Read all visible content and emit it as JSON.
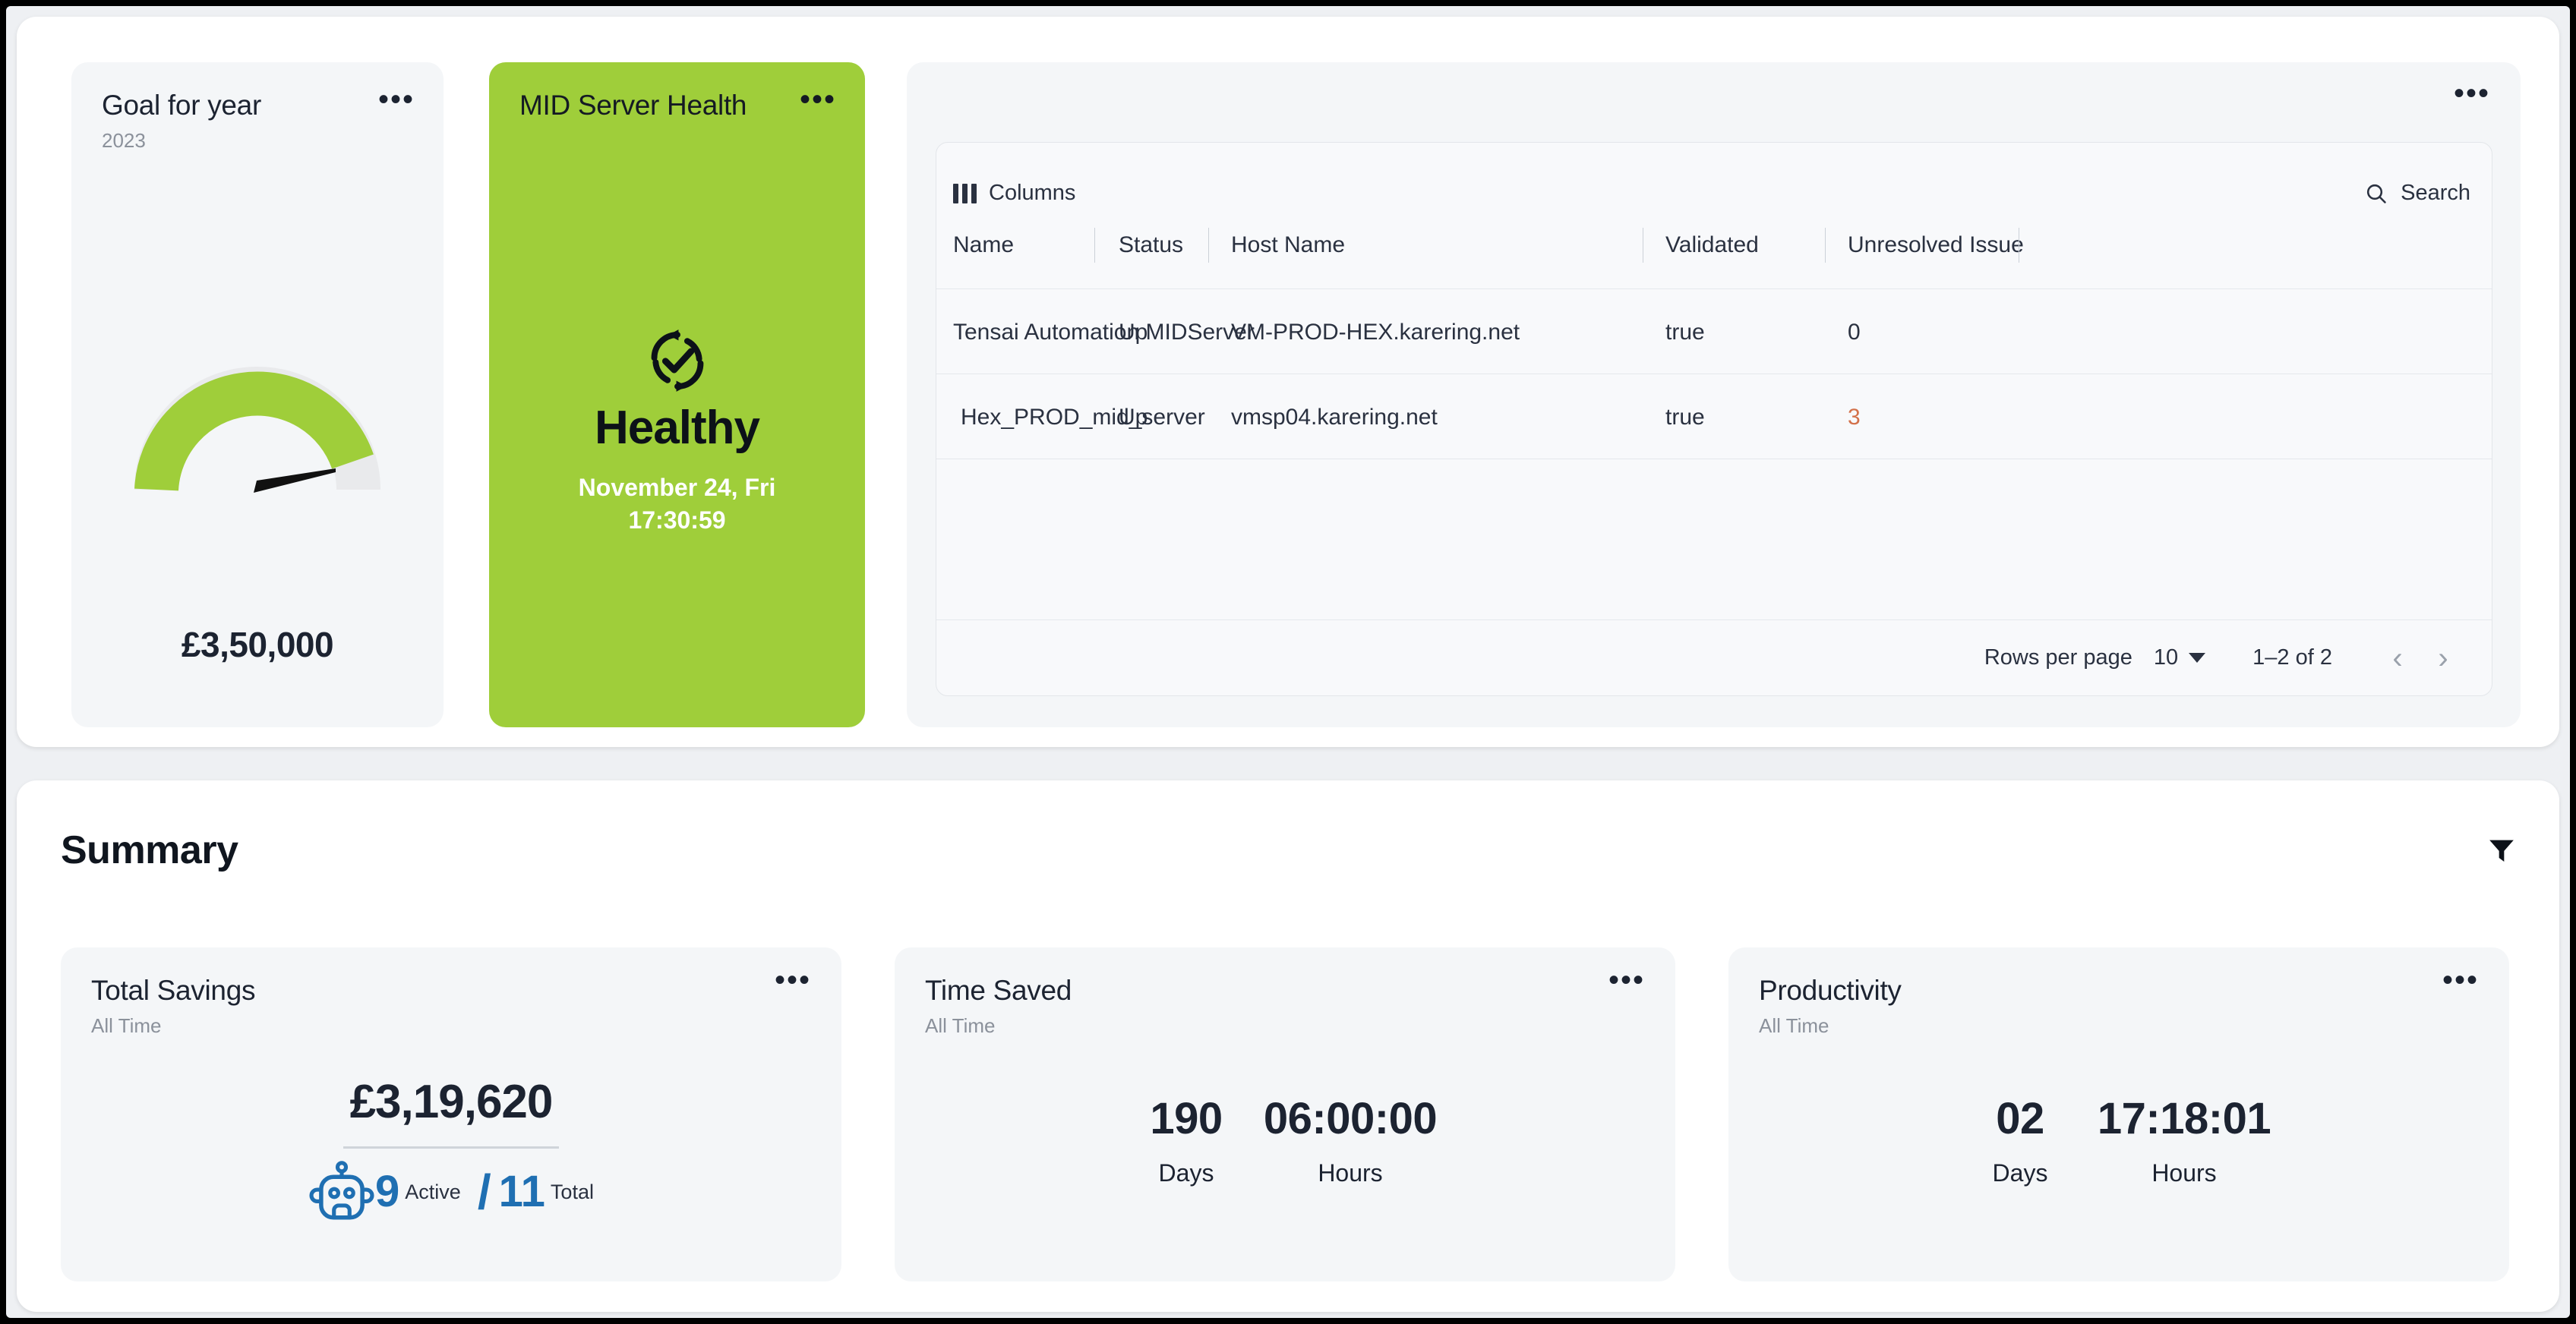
{
  "goal_card": {
    "title": "Goal for year",
    "subtitle": "2023",
    "value": "£3,50,000",
    "kebab": "•••",
    "gauge": {
      "percent": 91,
      "track_color": "#e9eaec",
      "fill_color": "#9fce3a",
      "needle_color": "#111111"
    }
  },
  "mid_card": {
    "title": "MID Server Health",
    "status": "Healthy",
    "date": "November 24, Fri",
    "time": "17:30:59",
    "kebab": "•••",
    "background_color": "#9fce3a"
  },
  "table_card": {
    "kebab": "•••",
    "toolbar": {
      "columns_label": "Columns",
      "search_label": "Search"
    },
    "columns": [
      "Name",
      "Status",
      "Host Name",
      "Validated",
      "Unresolved Issue"
    ],
    "rows": [
      {
        "name": "Tensai Automation MIDServer",
        "status": "Up",
        "host_name": "VM-PROD-HEX.karering.net",
        "validated": "true",
        "unresolved_issue": "0",
        "unresolved_warn": false
      },
      {
        "name": "Hex_PROD_mid_server",
        "status": "Up",
        "host_name": "vmsp04.karering.net",
        "validated": "true",
        "unresolved_issue": "3",
        "unresolved_warn": true
      }
    ],
    "pagination": {
      "rows_per_page_label": "Rows per page",
      "rows_per_page_value": "10",
      "range": "1–2 of 2",
      "prev": "‹",
      "next": "›"
    },
    "warn_color": "#d3714a"
  },
  "summary": {
    "title": "Summary",
    "cards": {
      "total_savings": {
        "title": "Total Savings",
        "subtitle": "All Time",
        "kebab": "•••",
        "value": "£3,19,620",
        "bots": {
          "active_count": "9",
          "active_label": "Active",
          "separator": "/",
          "total_count": "11",
          "total_label": "Total",
          "accent_color": "#1f6fb2"
        }
      },
      "time_saved": {
        "title": "Time Saved",
        "subtitle": "All Time",
        "kebab": "•••",
        "days_value": "190",
        "days_label": "Days",
        "hours_value": "06:00:00",
        "hours_label": "Hours"
      },
      "productivity": {
        "title": "Productivity",
        "subtitle": "All Time",
        "kebab": "•••",
        "days_value": "02",
        "days_label": "Days",
        "hours_value": "17:18:01",
        "hours_label": "Hours"
      }
    }
  },
  "chart_data": {
    "type": "gauge",
    "title": "Goal for year",
    "subtitle": "2023",
    "value": 350000,
    "value_label": "£3,50,000",
    "percent_filled": 91,
    "range": [
      0,
      100
    ],
    "needle_position_percent": 91,
    "colors": {
      "fill": "#9fce3a",
      "track": "#e9eaec",
      "needle": "#111111"
    }
  }
}
